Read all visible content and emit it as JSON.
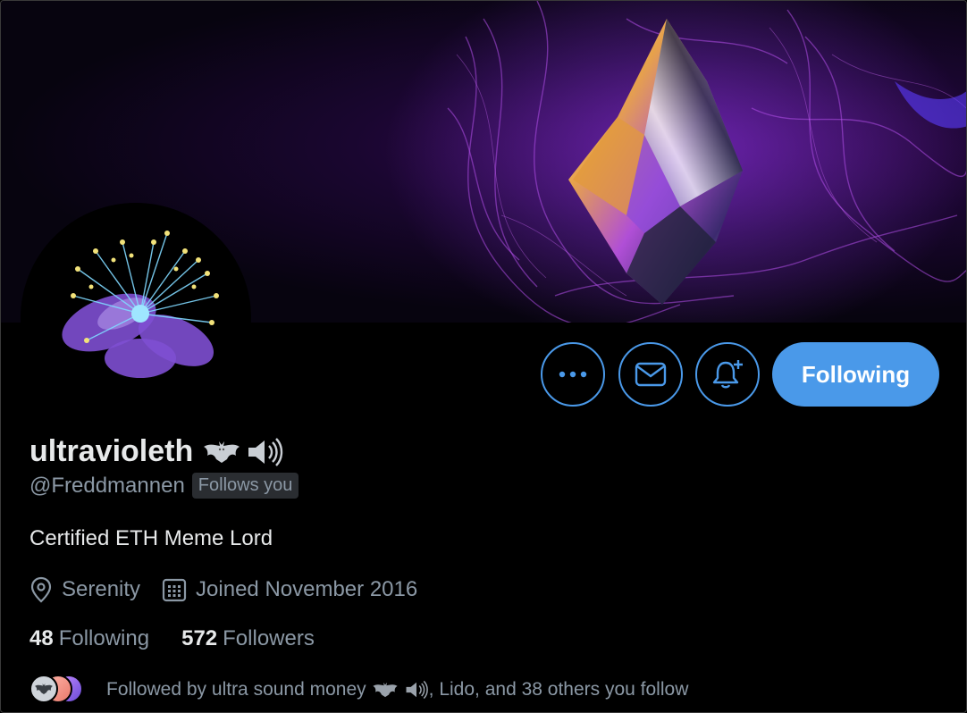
{
  "profile": {
    "display_name": "ultravioleth",
    "handle": "@Freddmannen",
    "follows_you": "Follows you",
    "bio": "Certified ETH Meme Lord",
    "location": "Serenity",
    "joined": "Joined November 2016",
    "following_count": "48",
    "following_label": "Following",
    "followers_count": "572",
    "followers_label": "Followers"
  },
  "actions": {
    "more_icon": "more-horizontal-icon",
    "message_icon": "envelope-icon",
    "notify_icon": "bell-plus-icon",
    "follow_button": "Following"
  },
  "followed_by": {
    "prefix": "Followed by ultra sound money",
    "suffix": ", Lido, and 38 others you follow"
  },
  "colors": {
    "accent": "#4a99e9",
    "background": "#000000",
    "text_primary": "#e7e9ea",
    "text_secondary": "#8b98a5"
  }
}
